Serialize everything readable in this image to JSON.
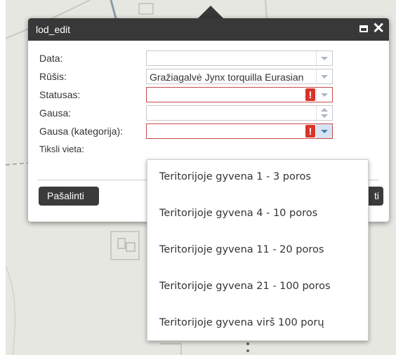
{
  "dialog": {
    "title": "lod_edit"
  },
  "form": {
    "fields": [
      {
        "label": "Data:",
        "value": ""
      },
      {
        "label": "Rūšis:",
        "value": "Gražiagalvė Jynx torquilla Eurasian"
      },
      {
        "label": "Statusas:",
        "value": ""
      },
      {
        "label": "Gausa:",
        "value": ""
      },
      {
        "label": "Gausa (kategorija):",
        "value": ""
      },
      {
        "label": "Tiksli vieta:",
        "value": ""
      }
    ],
    "error_mark": "!"
  },
  "buttons": {
    "delete_label": "Pašalinti",
    "save_label_visible": "ti"
  },
  "dropdown": {
    "options": [
      "Teritorijoje gyvena 1 - 3 poros",
      "Teritorijoje gyvena 4 - 10 poros",
      "Teritorijoje gyvena 11 - 20 poros",
      "Teritorijoje gyvena 21 - 100 poros",
      "Teritorijoje gyvena virš 100 porų"
    ]
  },
  "colors": {
    "titlebar": "#383838",
    "error": "#d9342b",
    "map": "#e7e7e2"
  }
}
